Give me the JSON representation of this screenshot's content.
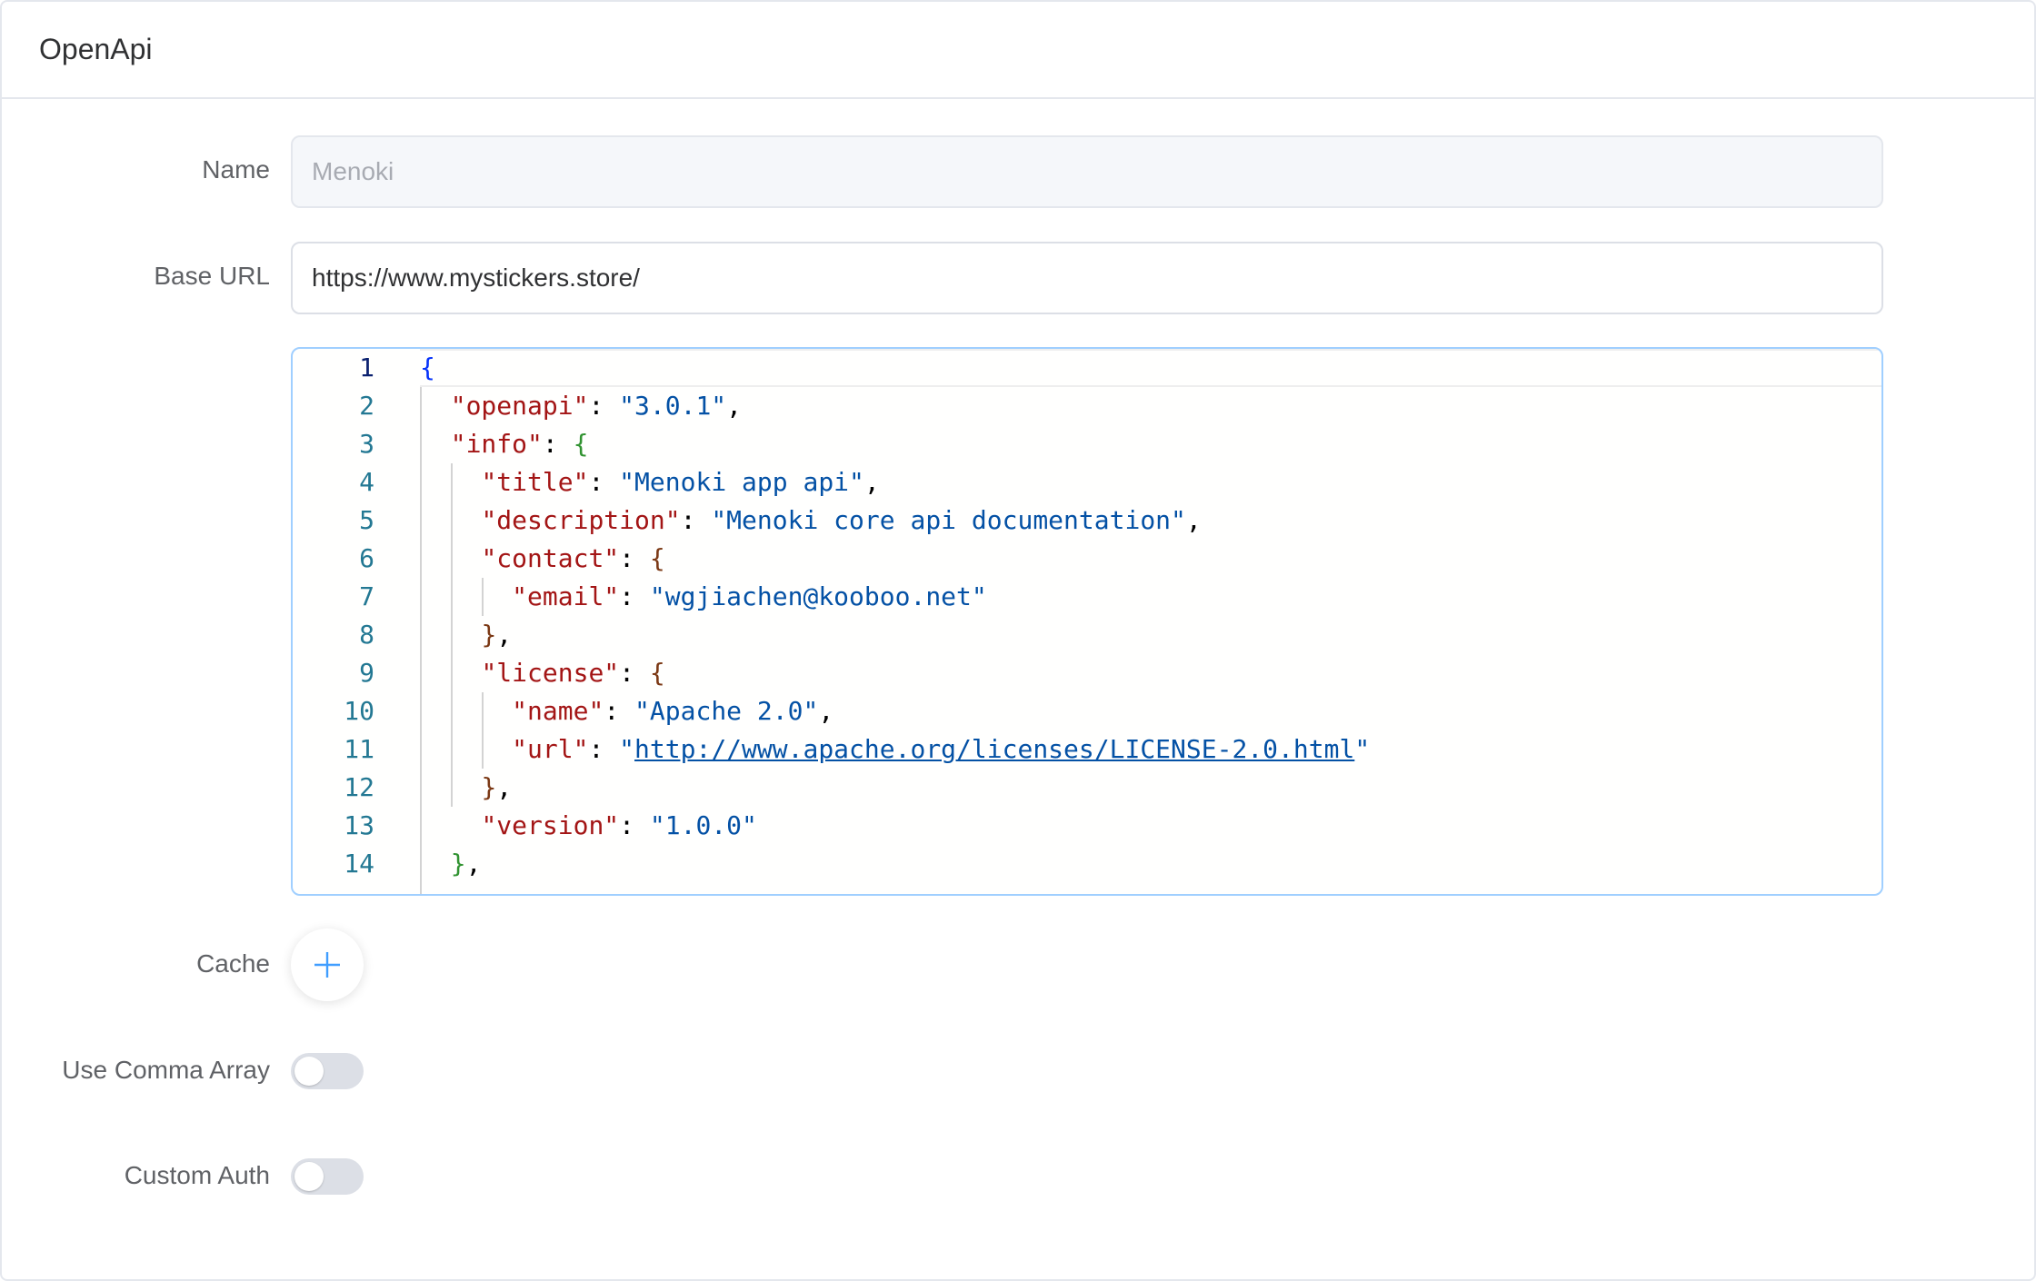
{
  "card": {
    "title": "OpenApi"
  },
  "form": {
    "name_label": "Name",
    "name_value": "Menoki",
    "base_url_label": "Base URL",
    "base_url_value": "https://www.mystickers.store/",
    "cache_label": "Cache",
    "use_comma_array_label": "Use Comma Array",
    "use_comma_array_on": false,
    "custom_auth_label": "Custom Auth",
    "custom_auth_on": false
  },
  "editor": {
    "line_numbers": [
      "1",
      "2",
      "3",
      "4",
      "5",
      "6",
      "7",
      "8",
      "9",
      "10",
      "11",
      "12",
      "13",
      "14"
    ],
    "active_line": 1,
    "code": {
      "openapi_key": "\"openapi\"",
      "openapi_val": "\"3.0.1\"",
      "info_key": "\"info\"",
      "title_key": "\"title\"",
      "title_val": "\"Menoki app api\"",
      "description_key": "\"description\"",
      "description_val": "\"Menoki core api documentation\"",
      "contact_key": "\"contact\"",
      "email_key": "\"email\"",
      "email_val": "\"wgjiachen@kooboo.net\"",
      "license_key": "\"license\"",
      "name_key": "\"name\"",
      "name_val": "\"Apache 2.0\"",
      "url_key": "\"url\"",
      "url_val": "http://www.apache.org/licenses/LICENSE-2.0.html",
      "version_key": "\"version\"",
      "version_val": "\"1.0.0\""
    }
  },
  "colors": {
    "json_key": "#a31515",
    "json_string": "#0451a5",
    "bracket_level1": "#0431fa",
    "bracket_level2": "#319331",
    "bracket_level3": "#7b3814",
    "line_number": "#237893",
    "accent": "#409eff"
  },
  "icons": {
    "cache_button": "plus-icon"
  }
}
